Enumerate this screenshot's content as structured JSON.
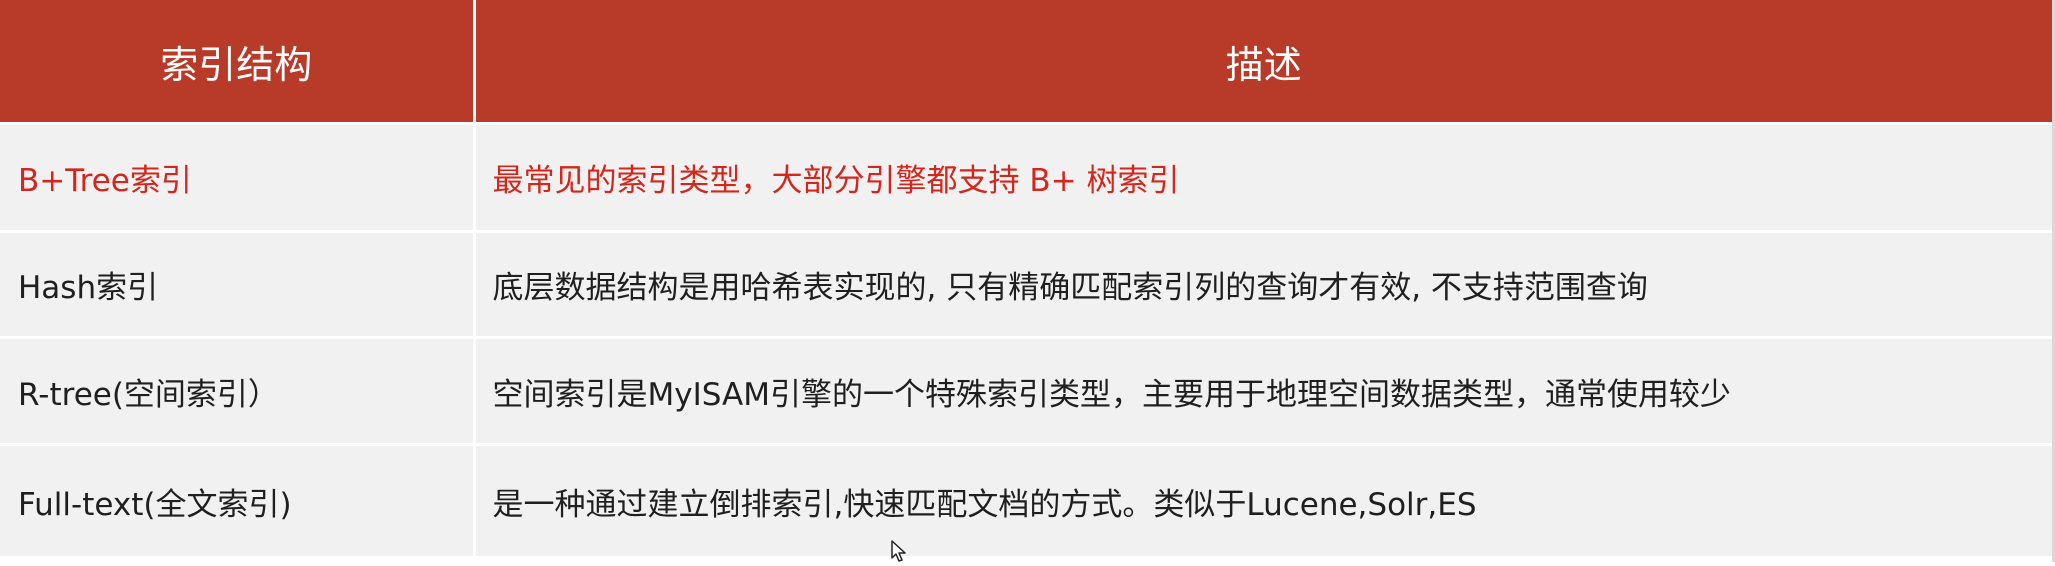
{
  "table": {
    "headers": [
      "索引结构",
      "描述"
    ],
    "rows": [
      {
        "structure": "B+Tree索引",
        "description": "最常见的索引类型，大部分引擎都支持 B+ 树索引",
        "highlighted": true
      },
      {
        "structure": "Hash索引",
        "description": "底层数据结构是用哈希表实现的, 只有精确匹配索引列的查询才有效, 不支持范围查询",
        "highlighted": false
      },
      {
        "structure": "R-tree(空间索引）",
        "description": "空间索引是MyISAM引擎的一个特殊索引类型，主要用于地理空间数据类型，通常使用较少",
        "highlighted": false
      },
      {
        "structure": "Full-text(全文索引)",
        "description": "是一种通过建立倒排索引,快速匹配文档的方式。类似于Lucene,Solr,ES",
        "highlighted": false
      }
    ]
  },
  "colors": {
    "header_bg": "#b83a28",
    "header_text": "#ffffff",
    "row_bg": "#f1f1f1",
    "highlight_text": "#d4261c",
    "body_text": "#1f1f1f"
  },
  "icons": {
    "cursor": "mouse-pointer-icon"
  }
}
